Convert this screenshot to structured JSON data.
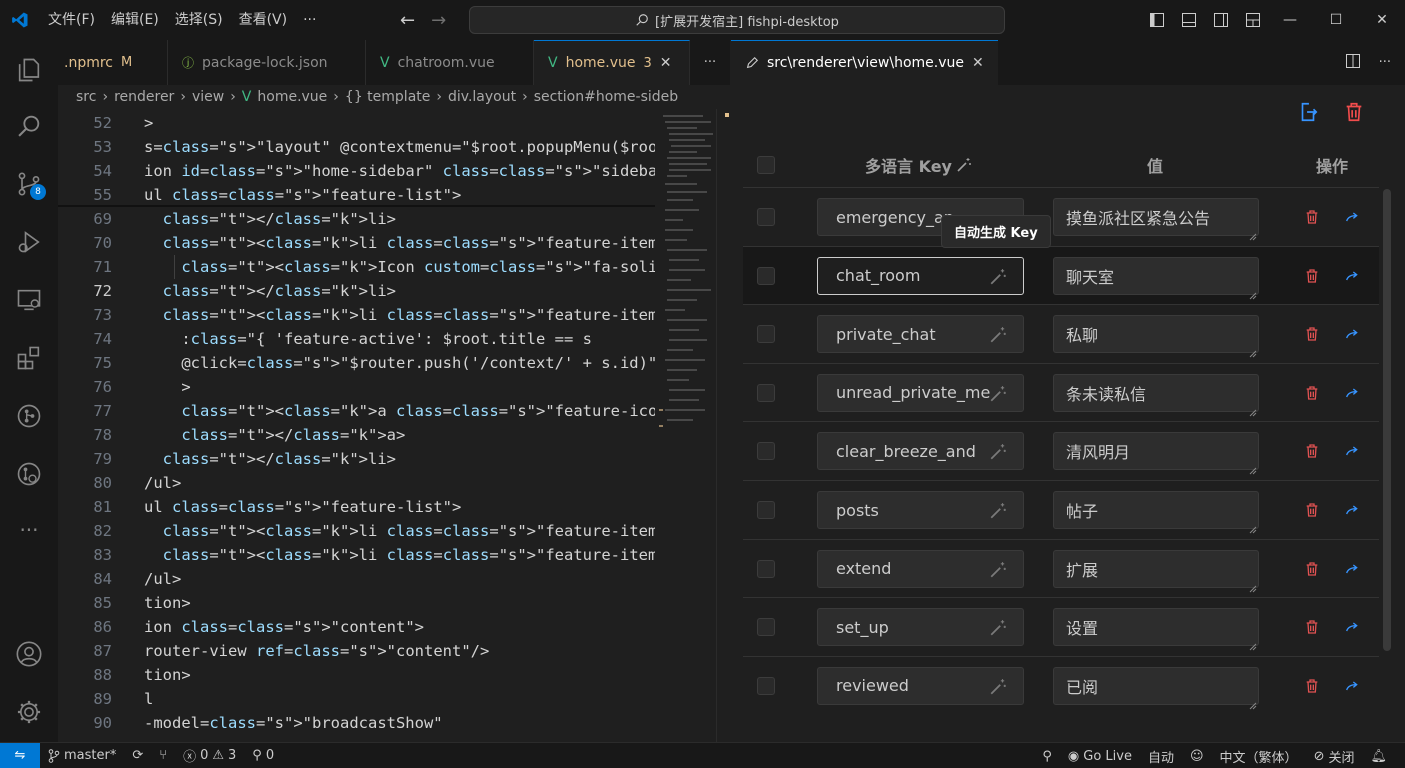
{
  "titlebar": {
    "menu": [
      "文件(F)",
      "编辑(E)",
      "选择(S)",
      "查看(V)",
      "···"
    ],
    "search_text": "[扩展开发宿主] fishpi-desktop",
    "minimize": "—",
    "maximize": "☐",
    "close": "✕"
  },
  "activity": {
    "source_control_badge": "8"
  },
  "tabs": [
    {
      "label": ".npmrc",
      "mark": "M"
    },
    {
      "label": "package-lock.json",
      "mark": ""
    },
    {
      "label": "chatroom.vue",
      "mark": ""
    },
    {
      "label": "home.vue",
      "mark": "3"
    }
  ],
  "breadcrumb": [
    "src",
    "renderer",
    "view",
    "home.vue",
    "{} template",
    "div.layout",
    "section#home-sideb"
  ],
  "code": {
    "lines": [
      {
        "n": "52",
        "text": ">"
      },
      {
        "n": "53",
        "text": "s=\"layout\" @contextmenu=\"$root.popupMenu($root.getDe"
      },
      {
        "n": "54",
        "text": "ion id=\"home-sidebar\" class=\"sidebar\">"
      },
      {
        "n": "55",
        "text": "ul class=\"feature-list\">"
      },
      {
        "n": "69",
        "text": "  </li>"
      },
      {
        "n": "70",
        "text": "  <li class=\"feature-item\" title=\"帖子\" :class=\"{ '"
      },
      {
        "n": "71",
        "text": "    <Icon custom=\"fa-solid fa-pen-clip\" />"
      },
      {
        "n": "72",
        "text": "  </li>"
      },
      {
        "n": "73",
        "text": "  <li class=\"feature-item\" :title=\"s.name\" v-bind:k"
      },
      {
        "n": "74",
        "text": "    :class=\"{ 'feature-active': $root.title == s"
      },
      {
        "n": "75",
        "text": "    @click=\"$router.push('/context/' + s.id)\""
      },
      {
        "n": "76",
        "text": "    >"
      },
      {
        "n": "77",
        "text": "    <a class=\"feature-icon\" :style=\"{ maskImage:"
      },
      {
        "n": "78",
        "text": "    </a>"
      },
      {
        "n": "79",
        "text": "  </li>"
      },
      {
        "n": "80",
        "text": "/ul>"
      },
      {
        "n": "81",
        "text": "ul class=\"feature-list\">"
      },
      {
        "n": "82",
        "text": "  <li class=\"feature-item\" title=\"扩展\" :class=\"{ '"
      },
      {
        "n": "83",
        "text": "  <li class=\"feature-item\" title=\"设置\" :class=\"{ '"
      },
      {
        "n": "84",
        "text": "/ul>"
      },
      {
        "n": "85",
        "text": "tion>"
      },
      {
        "n": "86",
        "text": "ion class=\"content\">"
      },
      {
        "n": "87",
        "text": "router-view ref=\"content\"/>"
      },
      {
        "n": "88",
        "text": "tion>"
      },
      {
        "n": "89",
        "text": "l"
      },
      {
        "n": "90",
        "text": "-model=\"broadcastShow\""
      }
    ]
  },
  "right_panel": {
    "tab_title": "src\\renderer\\view\\home.vue",
    "header": {
      "key": "多语言 Key",
      "value": "值",
      "actions": "操作"
    },
    "tooltip": "自动生成 Key",
    "rows": [
      {
        "key": "emergency_an",
        "value": "摸鱼派社区紧急公告"
      },
      {
        "key": "chat_room",
        "value": "聊天室"
      },
      {
        "key": "private_chat",
        "value": "私聊"
      },
      {
        "key": "unread_private_me",
        "value": "条未读私信"
      },
      {
        "key": "clear_breeze_and",
        "value": "清风明月"
      },
      {
        "key": "posts",
        "value": "帖子"
      },
      {
        "key": "extend",
        "value": "扩展"
      },
      {
        "key": "set_up",
        "value": "设置"
      },
      {
        "key": "reviewed",
        "value": "已阅"
      }
    ]
  },
  "statusbar": {
    "branch": "master*",
    "errors": "0",
    "warnings": "3",
    "ports": "0",
    "go_live": "Go Live",
    "auto": "自动",
    "language": "中文（繁体）",
    "off": "关闭"
  }
}
